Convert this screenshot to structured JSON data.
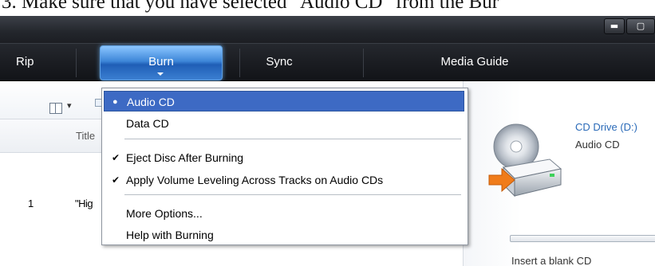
{
  "caption": {
    "text": "3.  Make sure that you have selected \"Audio CD\" from the Bur"
  },
  "window": {
    "minimize_glyph": "▬",
    "maximize_glyph": "▢"
  },
  "nav": {
    "tabs": [
      {
        "label": "Rip"
      },
      {
        "label": "Burn",
        "active": true
      },
      {
        "label": "Sync"
      },
      {
        "label": "Media Guide"
      }
    ]
  },
  "list": {
    "columns": {
      "title": "Title"
    },
    "rows": [
      {
        "number": "1",
        "title": "\"Hig"
      }
    ]
  },
  "right_panel": {
    "drive_name": "CD Drive (D:)",
    "media_type": "Audio CD",
    "insert_hint": "Insert a blank CD"
  },
  "burn_menu": {
    "items": [
      {
        "label": "Audio CD",
        "mark": "●",
        "selected": true
      },
      {
        "label": "Data CD",
        "mark": ""
      },
      {
        "label": "Eject Disc After Burning",
        "mark": "✔"
      },
      {
        "label": "Apply Volume Leveling Across Tracks on Audio CDs",
        "mark": "✔"
      },
      {
        "label": "More Options...",
        "mark": ""
      },
      {
        "label": "Help with Burning",
        "mark": ""
      }
    ]
  },
  "colors": {
    "selection": "#3d6ac4",
    "burn_tab": "#3d86d8",
    "navbar": "#1a1c21",
    "drive_label": "#2a6ab8"
  }
}
